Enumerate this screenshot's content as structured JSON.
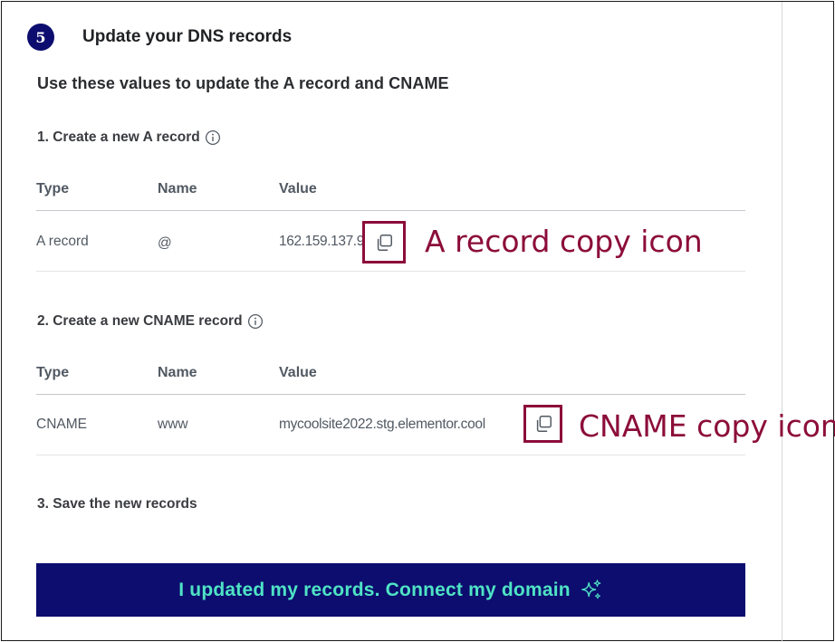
{
  "step": {
    "number": "5",
    "title": "Update your DNS records"
  },
  "intro": "Use these values to update the A record and CNAME",
  "a_record_section": {
    "label": "1. Create a new A record",
    "columns": [
      "Type",
      "Name",
      "Value"
    ],
    "row": {
      "type": "A record",
      "name": "@",
      "value": "162.159.137.9"
    }
  },
  "cname_section": {
    "label": "2. Create a new CNAME record",
    "columns": [
      "Type",
      "Name",
      "Value"
    ],
    "row": {
      "type": "CNAME",
      "name": "www",
      "value": "mycoolsite2022.stg.elementor.cool"
    }
  },
  "save_label": "3. Save the new records",
  "cta": {
    "label": "I updated my records. Connect my domain"
  },
  "annotations": {
    "a_record": "A record copy icon",
    "cname": "CNAME copy icon"
  },
  "colors": {
    "badge": "#0c0d6e",
    "cta_bg": "#0c0d6e",
    "cta_text": "#4fe3c5",
    "annotation": "#8c0d3a"
  },
  "icons": {
    "copy": "copy-icon",
    "info": "info-icon",
    "sparkle": "sparkle-icon"
  }
}
